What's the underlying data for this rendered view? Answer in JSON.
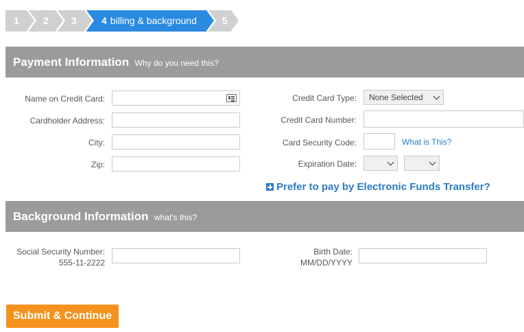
{
  "steps": [
    {
      "num": "1"
    },
    {
      "num": "2"
    },
    {
      "num": "3"
    },
    {
      "num": "4",
      "label": "billing & background"
    },
    {
      "num": "5"
    }
  ],
  "payment": {
    "title": "Payment Information",
    "subtitle": "Why do you need this?",
    "name_label": "Name on Credit Card:",
    "address_label": "Cardholder Address:",
    "city_label": "City:",
    "zip_label": "Zip:",
    "card_type_label": "Credit Card Type:",
    "card_type_value": "None Selected",
    "card_number_label": "Credit Card Number:",
    "security_label": "Card Security Code:",
    "what_is_this": "What is This?",
    "expiration_label": "Expiration Date:",
    "eft_link": "Prefer to pay by Electronic Funds Transfer?"
  },
  "background": {
    "title": "Background Information",
    "subtitle": "what's this?",
    "ssn_label": "Social Security Number:",
    "ssn_hint": "555-11-2222",
    "birth_label": "Birth Date:",
    "birth_hint": "MM/DD/YYYY"
  },
  "submit_label": "Submit & Continue",
  "colors": {
    "active_step": "#2a8ae0",
    "inactive_step": "#d0d0d0",
    "section_header": "#9b9b9b",
    "link": "#2a7bc4",
    "submit": "#f5921e"
  }
}
